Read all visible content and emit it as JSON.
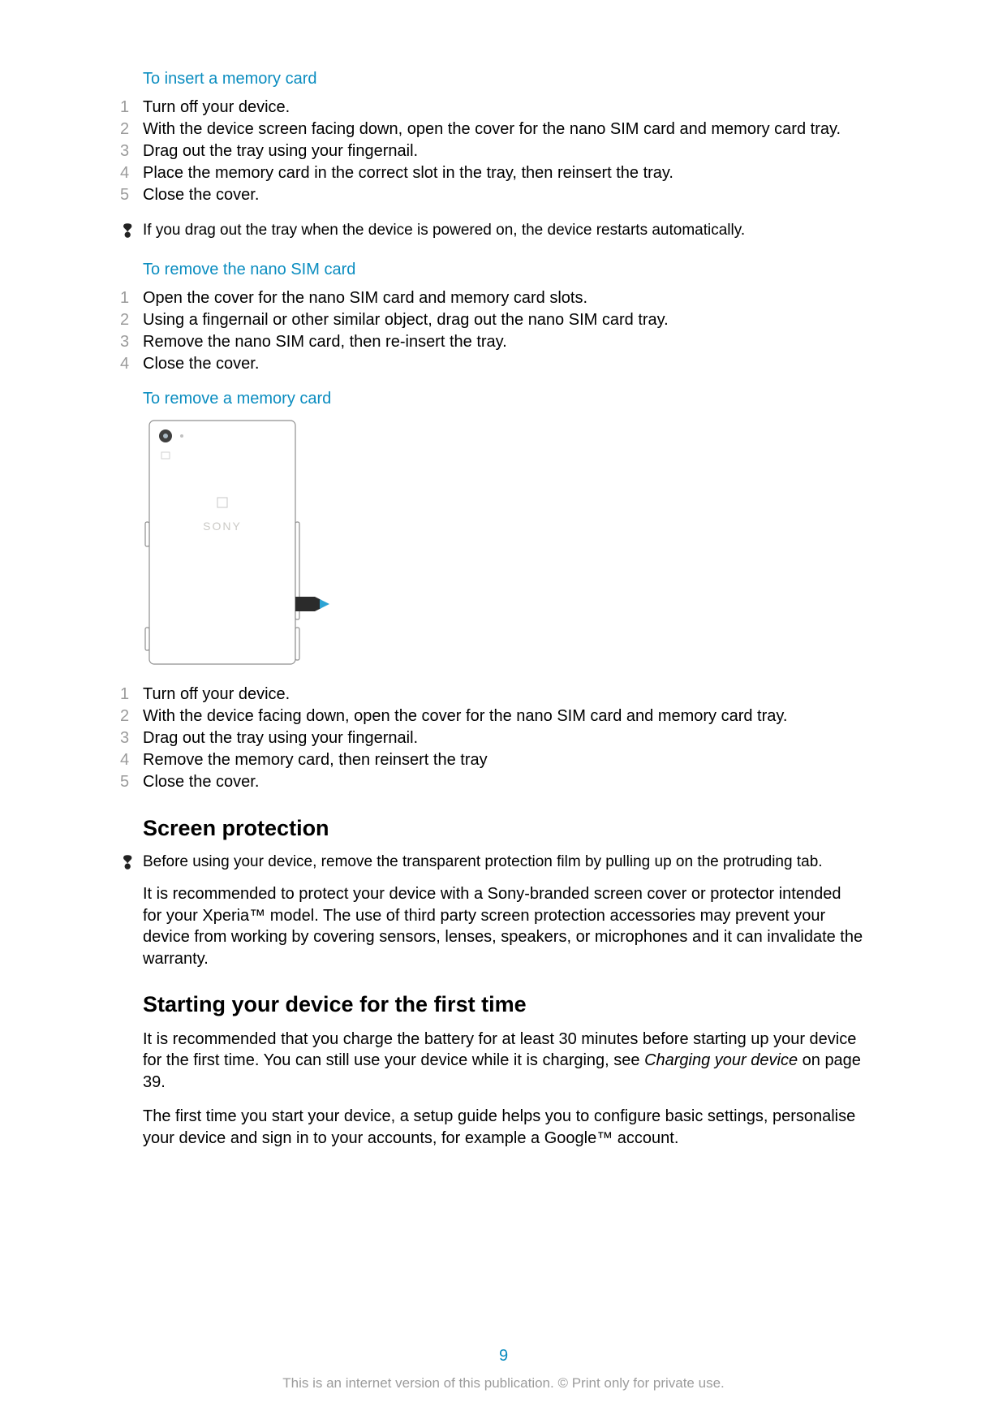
{
  "section1": {
    "title": "To insert a memory card",
    "steps": [
      "Turn off your device.",
      "With the device screen facing down, open the cover for the nano SIM card and memory card tray.",
      "Drag out the tray using your fingernail.",
      "Place the memory card in the correct slot in the tray, then reinsert the tray.",
      "Close the cover."
    ],
    "note": "If you drag out the tray when the device is powered on, the device restarts automatically."
  },
  "section2": {
    "title": "To remove the nano SIM card",
    "steps": [
      "Open the cover for the nano SIM card and memory card slots.",
      "Using a fingernail or other similar object, drag out the nano SIM card tray.",
      "Remove the nano SIM card, then re-insert the tray.",
      "Close the cover."
    ]
  },
  "section3": {
    "title": "To remove a memory card",
    "image_brand": "SONY",
    "steps": [
      "Turn off your device.",
      "With the device facing down, open the cover for the nano SIM card and memory card tray.",
      "Drag out the tray using your fingernail.",
      "Remove the memory card, then reinsert the tray",
      "Close the cover."
    ]
  },
  "section4": {
    "heading": "Screen protection",
    "note": "Before using your device, remove the transparent protection film by pulling up on the protruding tab.",
    "para": "It is recommended to protect your device with a Sony-branded screen cover or protector intended for your Xperia™ model. The use of third party screen protection accessories may prevent your device from working by covering sensors, lenses, speakers, or microphones and it can invalidate the warranty."
  },
  "section5": {
    "heading": "Starting your device for the first time",
    "para1_a": "It is recommended that you charge the battery for at least 30 minutes before starting up your device for the first time. You can still use your device while it is charging, see ",
    "para1_link": "Charging your device",
    "para1_b": " on page 39.",
    "para2": "The first time you start your device, a setup guide helps you to configure basic settings, personalise your device and sign in to your accounts, for example a Google™ account."
  },
  "page_number": "9",
  "footer": "This is an internet version of this publication. © Print only for private use."
}
